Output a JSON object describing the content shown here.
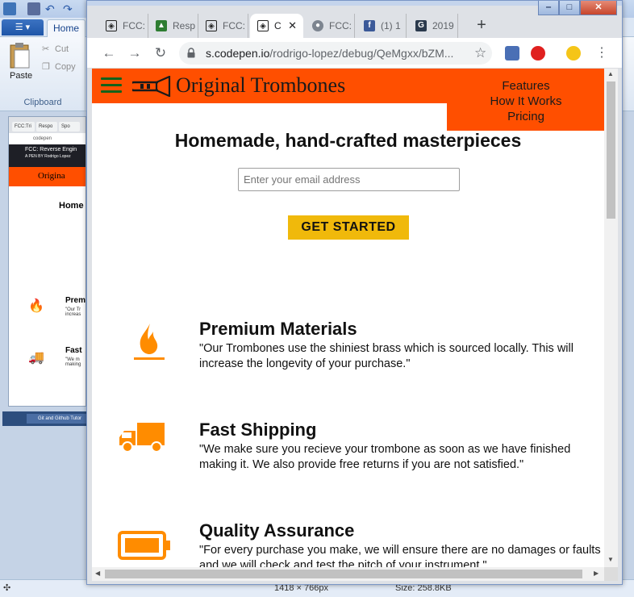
{
  "paint": {
    "file_menu": "",
    "home_tab": "Home",
    "clipboard": {
      "paste": "Paste",
      "cut": "Cut",
      "copy": "Copy",
      "group_label": "Clipboard"
    },
    "status": {
      "dimensions": "1418 × 766px",
      "size": "Size: 258.8KB"
    },
    "thumbnail": {
      "tabs": [
        "FCC:Tri",
        "Respo",
        "Spo"
      ],
      "url": "codepen",
      "banner_title": "FCC: Reverse Engin",
      "banner_author": "A PEN BY Rodrigo Lopez",
      "site_title": "Origina",
      "hero": "Home",
      "features": [
        {
          "title": "Prem",
          "desc": "\"Our Tr increas"
        },
        {
          "title": "Fast",
          "desc": "\"We m making"
        }
      ],
      "taskbar_item": "Git and Github Tutor"
    }
  },
  "browser": {
    "tabs": [
      {
        "label": "FCC:",
        "icon": "codepen-icon"
      },
      {
        "label": "Resp",
        "icon": "android-icon"
      },
      {
        "label": "FCC:",
        "icon": "codepen-icon"
      },
      {
        "label": "C",
        "icon": "codepen-icon"
      },
      {
        "label": "FCC:",
        "icon": "globe-icon"
      },
      {
        "label": "(1) 1",
        "icon": "facebook-icon"
      },
      {
        "label": "2019",
        "icon": "g-icon"
      }
    ],
    "url_host": "s.codepen.io",
    "url_path": "/rodrigo-lopez/debug/QeMgxx/bZM...",
    "colors": {
      "header": "#ff4f00",
      "cta": "#f0b90b",
      "icon": "#ff8c00",
      "hamburger": "#14621a"
    }
  },
  "site": {
    "title": "Original Trombones",
    "nav": [
      "Features",
      "How It Works",
      "Pricing"
    ],
    "hero": "Homemade, hand-crafted masterpieces",
    "email_placeholder": "Enter your email address",
    "cta": "GET STARTED",
    "features": [
      {
        "icon": "fire-icon",
        "title": "Premium Materials",
        "desc": "\"Our Trombones use the shiniest brass which is sourced locally. This will increase the longevity of your purchase.\""
      },
      {
        "icon": "truck-icon",
        "title": "Fast Shipping",
        "desc": "\"We make sure you recieve your trombone as soon as we have finished making it. We also provide free returns if you are not satisfied.\""
      },
      {
        "icon": "battery-icon",
        "title": "Quality Assurance",
        "desc": "\"For every purchase you make, we will ensure there are no damages or faults and we will check and test the pitch of your instrument.\""
      }
    ]
  }
}
